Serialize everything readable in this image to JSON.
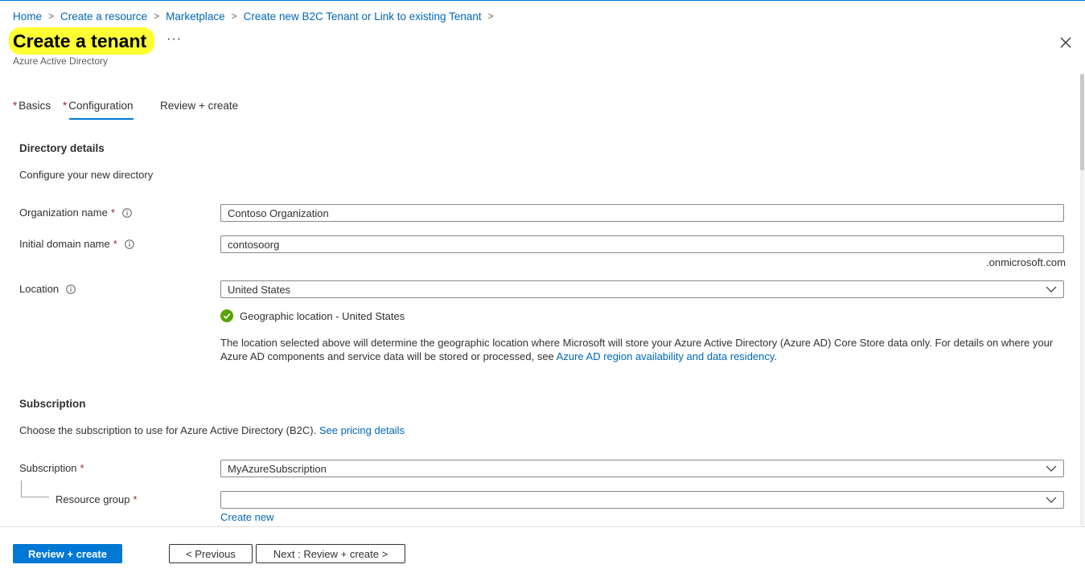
{
  "breadcrumb": {
    "items": [
      "Home",
      "Create a resource",
      "Marketplace",
      "Create new B2C Tenant or Link to existing Tenant"
    ],
    "separator": ">"
  },
  "header": {
    "title": "Create a tenant",
    "subtitle": "Azure Active Directory",
    "more_label": "···",
    "highlight_color": "#ffff33"
  },
  "tabs": [
    {
      "label": "Basics",
      "required": "*"
    },
    {
      "label": "Configuration",
      "required": "*"
    },
    {
      "label": "Review + create"
    }
  ],
  "directory": {
    "section_title": "Directory details",
    "description": "Configure your new directory",
    "org_label": "Organization name",
    "org_value": "Contoso Organization",
    "domain_label": "Initial domain name",
    "domain_value": "contosoorg",
    "domain_suffix": ".onmicrosoft.com",
    "location_label": "Location",
    "location_value": "United States",
    "geo_message": "Geographic location - United States",
    "geo_note": "The location selected above will determine the geographic location where Microsoft will store your Azure Active Directory (Azure AD) Core Store data only. For details on where your Azure AD components and service data will be stored or processed, see ",
    "geo_link": "Azure AD region availability and data residency",
    "geo_note_end": ".",
    "required_mark": "*"
  },
  "subscription": {
    "section_title": "Subscription",
    "description": "Choose the subscription to use for Azure Active Directory (B2C). ",
    "pricing_link": "See pricing details",
    "subscription_label": "Subscription",
    "subscription_value": "MyAzureSubscription",
    "rg_label": "Resource group",
    "rg_value": "",
    "create_new": "Create new",
    "required_mark": "*"
  },
  "footer": {
    "review_create": "Review + create",
    "previous": "< Previous",
    "next": "Next : Review + create >"
  },
  "colors": {
    "accent": "#0078d4",
    "link": "#0066b8",
    "required": "#a4262c",
    "success": "#57a300"
  }
}
